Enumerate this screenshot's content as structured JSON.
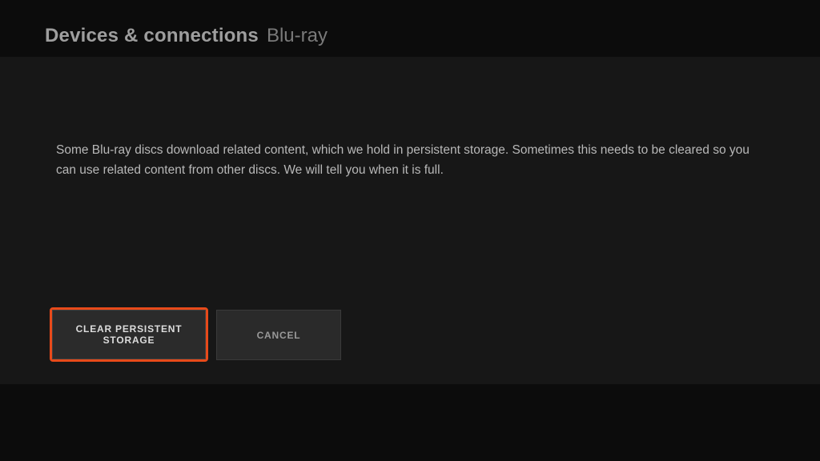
{
  "header": {
    "title": "Devices & connections",
    "subtitle": "Blu-ray"
  },
  "main": {
    "description": "Some Blu-ray discs download related content, which we hold in persistent storage.  Sometimes this needs to be cleared so you can use related content from other discs. We will tell you when it is full."
  },
  "buttons": {
    "primary_label": "CLEAR PERSISTENT STORAGE",
    "secondary_label": "CANCEL"
  },
  "colors": {
    "focus_border": "#e84a1a"
  }
}
